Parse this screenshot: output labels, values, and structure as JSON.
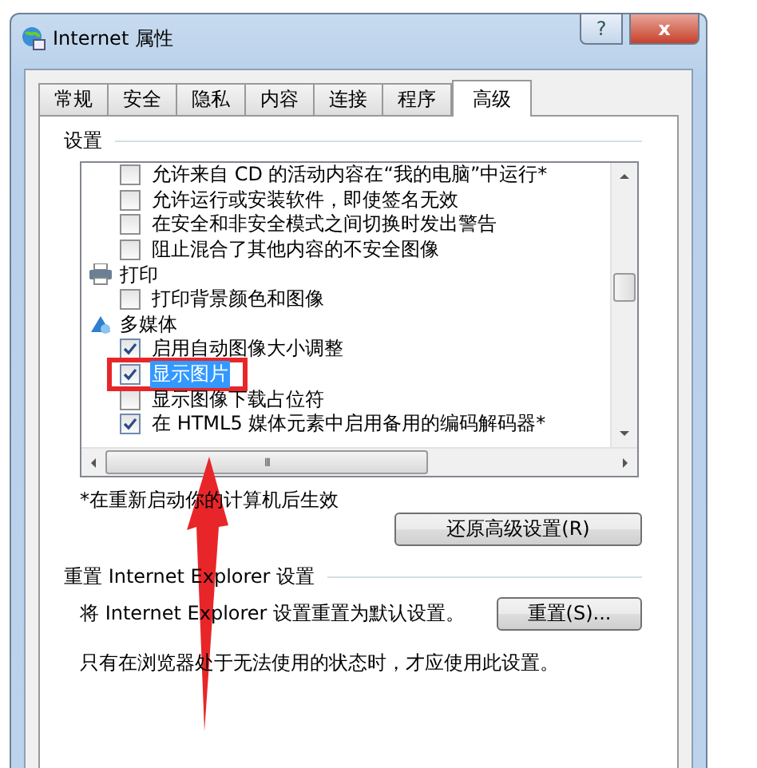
{
  "window": {
    "title": "Internet 属性",
    "help_button": "?",
    "close_button": "x"
  },
  "tabs": [
    {
      "label": "常规",
      "selected": false
    },
    {
      "label": "安全",
      "selected": false
    },
    {
      "label": "隐私",
      "selected": false
    },
    {
      "label": "内容",
      "selected": false
    },
    {
      "label": "连接",
      "selected": false
    },
    {
      "label": "程序",
      "selected": false
    },
    {
      "label": "高级",
      "selected": true
    }
  ],
  "settings": {
    "heading": "设置",
    "items": [
      {
        "kind": "checkbox",
        "label": "允许来自 CD 的活动内容在“我的电脑”中运行*",
        "checked": false,
        "selected": false
      },
      {
        "kind": "checkbox",
        "label": "允许运行或安装软件，即使签名无效",
        "checked": false,
        "selected": false
      },
      {
        "kind": "checkbox",
        "label": "在安全和非安全模式之间切换时发出警告",
        "checked": false,
        "selected": false
      },
      {
        "kind": "checkbox",
        "label": "阻止混合了其他内容的不安全图像",
        "checked": false,
        "selected": false
      },
      {
        "kind": "category",
        "label": "打印"
      },
      {
        "kind": "checkbox",
        "label": "打印背景颜色和图像",
        "checked": false,
        "selected": false
      },
      {
        "kind": "category",
        "label": "多媒体"
      },
      {
        "kind": "checkbox",
        "label": "启用自动图像大小调整",
        "checked": true,
        "selected": false
      },
      {
        "kind": "checkbox",
        "label": "显示图片",
        "checked": true,
        "selected": true
      },
      {
        "kind": "checkbox",
        "label": "显示图像下载占位符",
        "checked": false,
        "selected": false
      },
      {
        "kind": "checkbox",
        "label": "在 HTML5 媒体元素中启用备用的编码解码器*",
        "checked": true,
        "selected": false
      }
    ],
    "scrollbar_grip": "III",
    "note": "*在重新启动你的计算机后生效",
    "restore_button": "还原高级设置(R)"
  },
  "reset_group": {
    "heading": "重置 Internet Explorer 设置",
    "description": "将 Internet Explorer 设置重置为默认设置。",
    "reset_button": "重置(S)...",
    "warning": "只有在浏览器处于无法使用的状态时，才应使用此设置。"
  }
}
